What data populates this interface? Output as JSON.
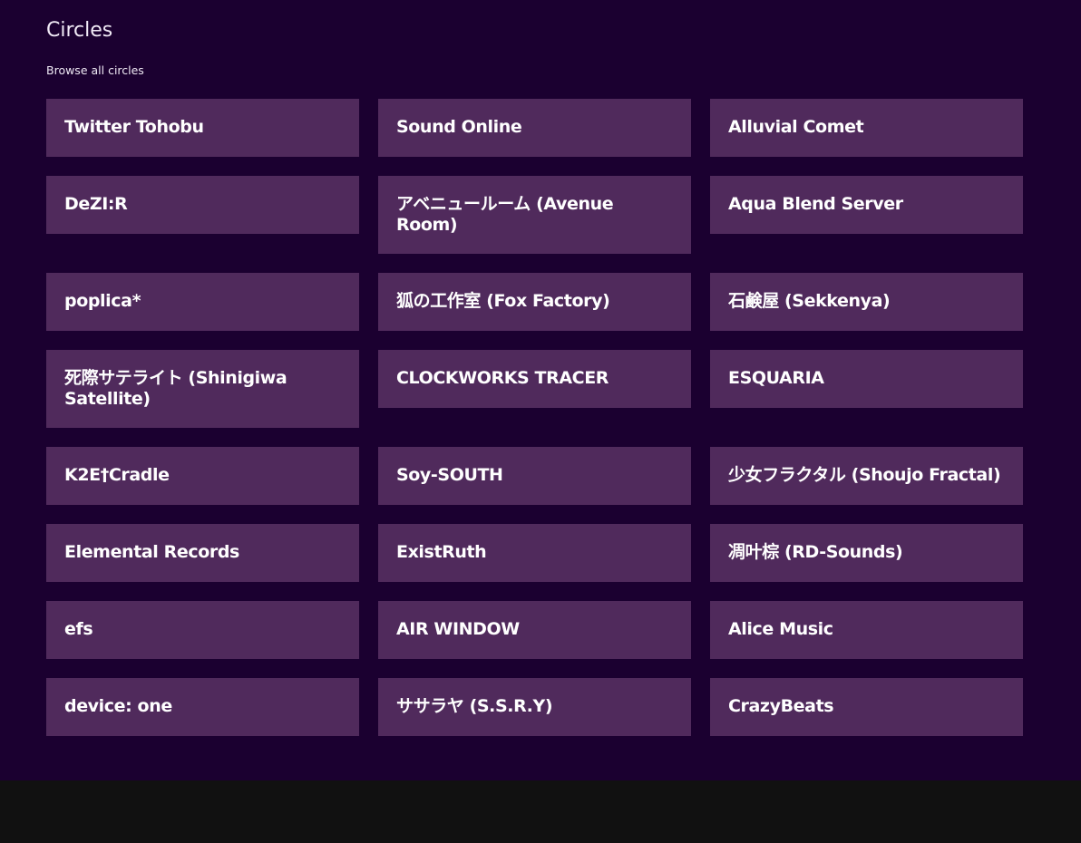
{
  "header": {
    "title": "Circles",
    "subtitle": "Browse all circles"
  },
  "circles": [
    {
      "label": "Twitter Tohobu"
    },
    {
      "label": "Sound Online"
    },
    {
      "label": "Alluvial Comet"
    },
    {
      "label": "DeZI:R"
    },
    {
      "label": "アベニュールーム (Avenue Room)"
    },
    {
      "label": "Aqua Blend Server"
    },
    {
      "label": "poplica*"
    },
    {
      "label": "狐の工作室 (Fox Factory)"
    },
    {
      "label": "石鹸屋 (Sekkenya)"
    },
    {
      "label": "死際サテライト (Shinigiwa Satellite)"
    },
    {
      "label": "CLOCKWORKS TRACER"
    },
    {
      "label": "ESQUARIA"
    },
    {
      "label": "K2E†Cradle"
    },
    {
      "label": "Soy-SOUTH"
    },
    {
      "label": "少女フラクタル (Shoujo Fractal)"
    },
    {
      "label": "Elemental Records"
    },
    {
      "label": "ExistRuth"
    },
    {
      "label": "凋叶棕 (RD-Sounds)"
    },
    {
      "label": "efs"
    },
    {
      "label": "AIR WINDOW"
    },
    {
      "label": "Alice Music"
    },
    {
      "label": "device: one"
    },
    {
      "label": "ササラヤ (S.S.R.Y)"
    },
    {
      "label": "CrazyBeats"
    }
  ],
  "colors": {
    "background": "#1b0030",
    "tile": "#502a5c",
    "text": "#ffffff",
    "footer": "#111111"
  }
}
